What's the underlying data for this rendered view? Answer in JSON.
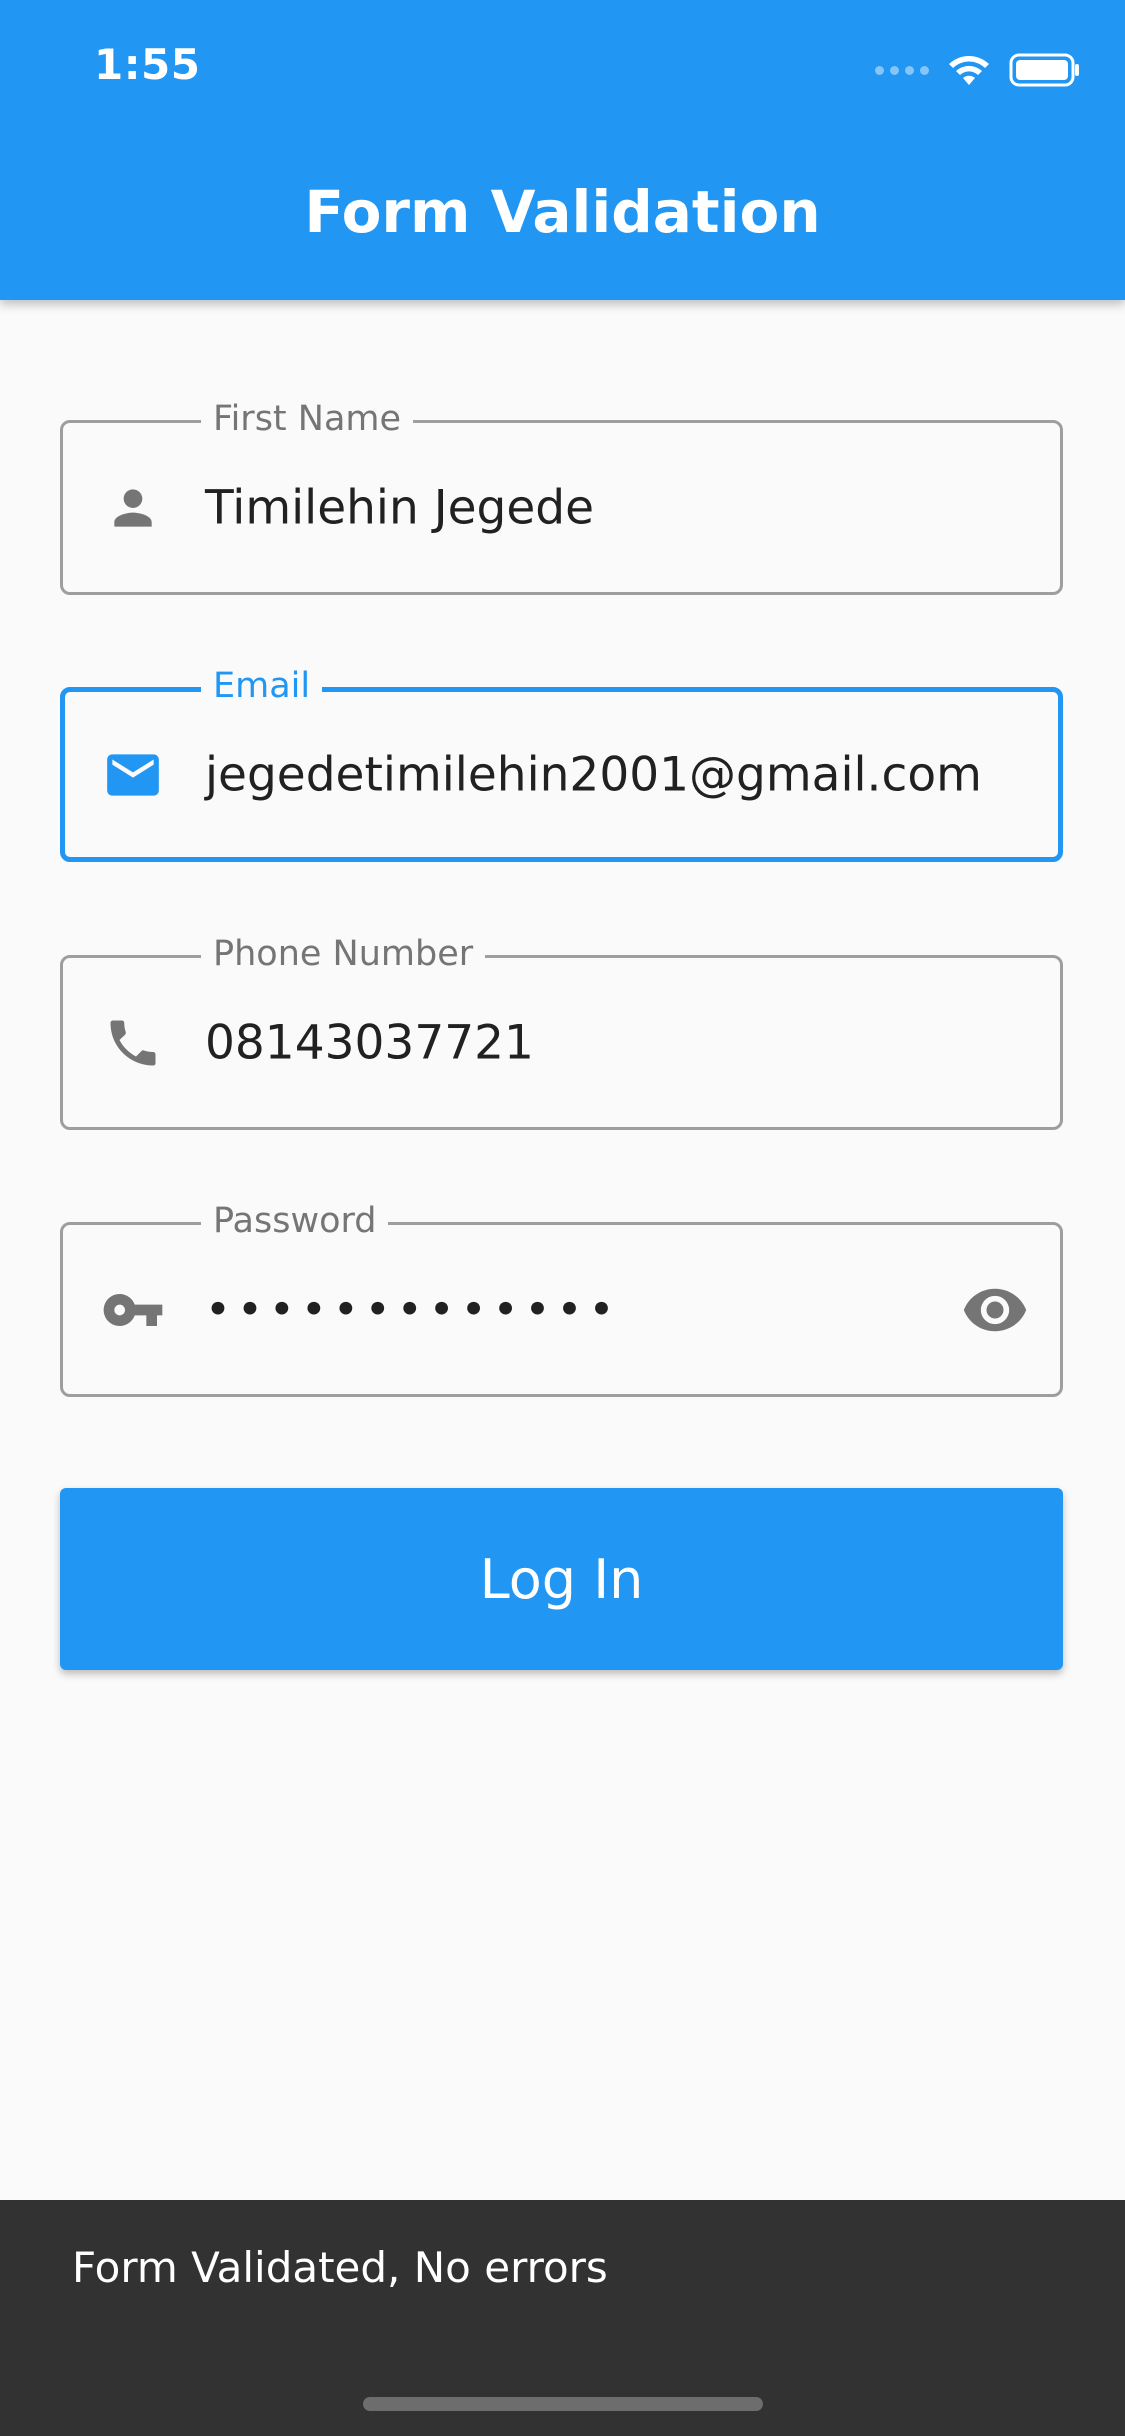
{
  "status_bar": {
    "time": "1:55"
  },
  "appbar": {
    "title": "Form Validation"
  },
  "form": {
    "first_name": {
      "label": "First Name",
      "value": "Timilehin Jegede",
      "icon": "person-icon"
    },
    "email": {
      "label": "Email",
      "value": "jegedetimilehin2001@gmail.com",
      "icon": "mail-icon",
      "focused": true
    },
    "phone": {
      "label": "Phone Number",
      "value": "08143037721",
      "icon": "phone-icon"
    },
    "password": {
      "label": "Password",
      "value": "•••••••••••••",
      "icon": "key-icon",
      "toggle_icon": "eye-icon"
    },
    "submit_label": "Log In"
  },
  "snackbar": {
    "message": "Form Validated, No errors"
  },
  "colors": {
    "primary": "#2196f3",
    "snackbar": "#323232",
    "icon_grey": "#757575"
  }
}
